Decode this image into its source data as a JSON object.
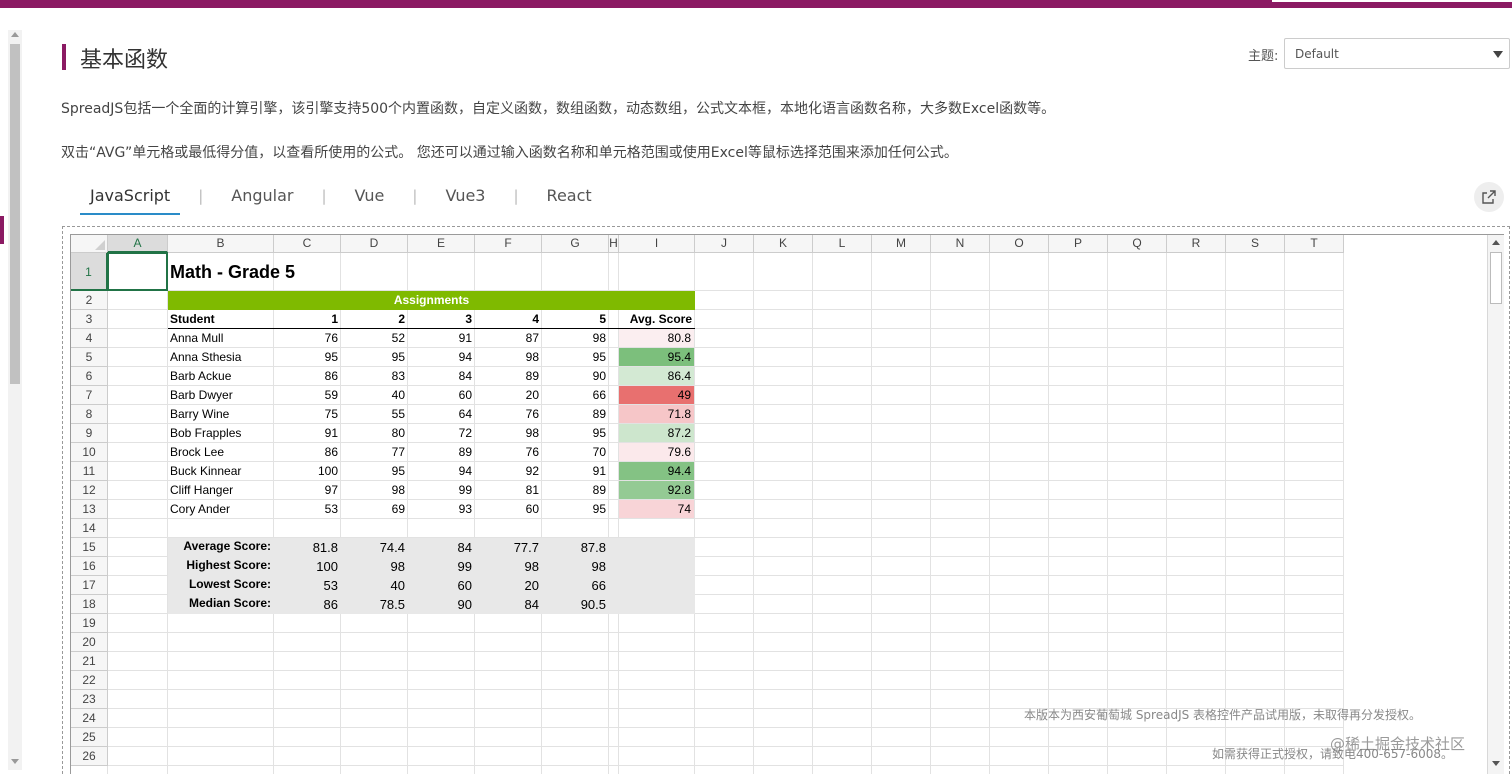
{
  "page": {
    "title": "基本函数",
    "theme_label": "主题:",
    "theme_value": "Default",
    "description_1": "SpreadJS包括一个全面的计算引擎，该引擎支持500个内置函数，自定义函数，数组函数，动态数组，公式文本框，本地化语言函数名称，大多数Excel函数等。",
    "description_2": "双击“AVG”单元格或最低得分值，以查看所使用的公式。 您还可以通过输入函数名称和单元格范围或使用Excel等鼠标选择范围来添加任何公式。"
  },
  "tabs": [
    {
      "label": "JavaScript",
      "active": true
    },
    {
      "label": "Angular",
      "active": false
    },
    {
      "label": "Vue",
      "active": false
    },
    {
      "label": "Vue3",
      "active": false
    },
    {
      "label": "React",
      "active": false
    }
  ],
  "colors": {
    "brand": "#8b1a63",
    "tab_underline": "#2a8cc8",
    "assignments_bar": "#7fba00",
    "summary_bg": "#e8e8e8",
    "selection": "#217346"
  },
  "sheet": {
    "selected_cell": "A1",
    "columns": [
      "A",
      "B",
      "C",
      "D",
      "E",
      "F",
      "G",
      "H",
      "I",
      "J",
      "K",
      "L",
      "M",
      "N",
      "O",
      "P",
      "Q",
      "R",
      "S",
      "T"
    ],
    "rows": [
      "1",
      "2",
      "3",
      "4",
      "5",
      "6",
      "7",
      "8",
      "9",
      "10",
      "11",
      "12",
      "13",
      "14",
      "15",
      "16",
      "17",
      "18",
      "19",
      "20",
      "21",
      "22",
      "23",
      "24",
      "25",
      "26"
    ],
    "title": "Math - Grade 5",
    "assignments_label": "Assignments",
    "header": {
      "student": "Student",
      "assignments": [
        "1",
        "2",
        "3",
        "4",
        "5"
      ],
      "avg": "Avg. Score"
    },
    "students": [
      {
        "name": "Anna Mull",
        "scores": [
          "76",
          "52",
          "91",
          "87",
          "98"
        ],
        "avg": "80.8",
        "avg_color": "#fbeef0"
      },
      {
        "name": "Anna Sthesia",
        "scores": [
          "95",
          "95",
          "94",
          "98",
          "95"
        ],
        "avg": "95.4",
        "avg_color": "#7cbf7c"
      },
      {
        "name": "Barb Ackue",
        "scores": [
          "86",
          "83",
          "84",
          "89",
          "90"
        ],
        "avg": "86.4",
        "avg_color": "#d3e9d3"
      },
      {
        "name": "Barb Dwyer",
        "scores": [
          "59",
          "40",
          "60",
          "20",
          "66"
        ],
        "avg": "49",
        "avg_color": "#e8706f"
      },
      {
        "name": "Barry Wine",
        "scores": [
          "75",
          "55",
          "64",
          "76",
          "89"
        ],
        "avg": "71.8",
        "avg_color": "#f6c6c8"
      },
      {
        "name": "Bob Frapples",
        "scores": [
          "91",
          "80",
          "72",
          "98",
          "95"
        ],
        "avg": "87.2",
        "avg_color": "#cde6cd"
      },
      {
        "name": "Brock Lee",
        "scores": [
          "86",
          "77",
          "89",
          "76",
          "70"
        ],
        "avg": "79.6",
        "avg_color": "#fbe9eb"
      },
      {
        "name": "Buck Kinnear",
        "scores": [
          "100",
          "95",
          "94",
          "92",
          "91"
        ],
        "avg": "94.4",
        "avg_color": "#84c284"
      },
      {
        "name": "Cliff Hanger",
        "scores": [
          "97",
          "98",
          "99",
          "81",
          "89"
        ],
        "avg": "92.8",
        "avg_color": "#94ca94"
      },
      {
        "name": "Cory Ander",
        "scores": [
          "53",
          "69",
          "93",
          "60",
          "95"
        ],
        "avg": "74",
        "avg_color": "#f8d4d7"
      }
    ],
    "summary": [
      {
        "label": "Average Score:",
        "values": [
          "81.8",
          "74.4",
          "84",
          "77.7",
          "87.8"
        ]
      },
      {
        "label": "Highest Score:",
        "values": [
          "100",
          "98",
          "99",
          "98",
          "98"
        ]
      },
      {
        "label": "Lowest Score:",
        "values": [
          "53",
          "40",
          "60",
          "20",
          "66"
        ]
      },
      {
        "label": "Median Score:",
        "values": [
          "86",
          "78.5",
          "90",
          "84",
          "90.5"
        ]
      }
    ]
  },
  "watermark": {
    "line1": "本版本为西安葡萄城 SpreadJS 表格控件产品试用版，未取得再分发授权。",
    "line2": "如需获得正式授权，请致电400-657-6008。",
    "overlay": "@稀土掘金技术社区"
  }
}
